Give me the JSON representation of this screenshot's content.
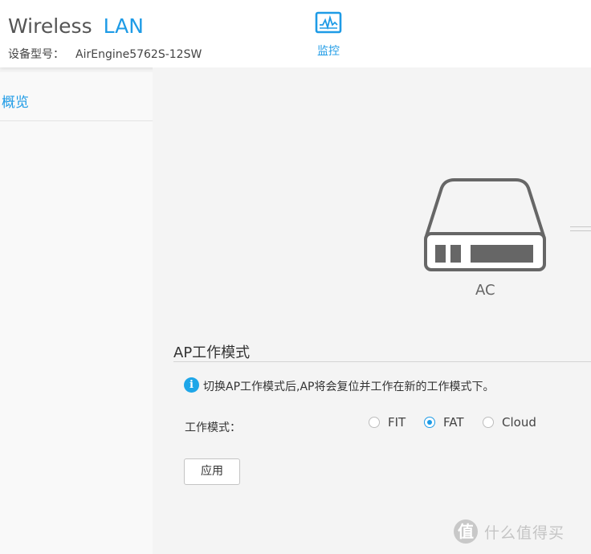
{
  "header": {
    "brand_part1": "Wireless",
    "brand_part2": "LAN",
    "model_label": "设备型号：",
    "model_value": "AirEngine5762S-12SW",
    "monitor_tab_label": "监控"
  },
  "sidebar": {
    "items": [
      {
        "label": "概览"
      }
    ]
  },
  "topology": {
    "device_label": "AC"
  },
  "ap_mode": {
    "title": "AP工作模式",
    "info_text": "切换AP工作模式后,AP将会复位并工作在新的工作模式下。",
    "mode_label": "工作模式：",
    "options": [
      {
        "label": "FIT",
        "selected": false
      },
      {
        "label": "FAT",
        "selected": true
      },
      {
        "label": "Cloud",
        "selected": false
      }
    ],
    "apply_label": "应用"
  },
  "watermark": {
    "glyph": "值",
    "text": "什么值得买"
  },
  "colors": {
    "accent": "#1e9be6",
    "page_background": "#f4f4f4",
    "device_stroke": "#666666"
  },
  "icons": [
    "monitor-icon",
    "ac-device-icon",
    "info-icon",
    "watermark-logo"
  ]
}
